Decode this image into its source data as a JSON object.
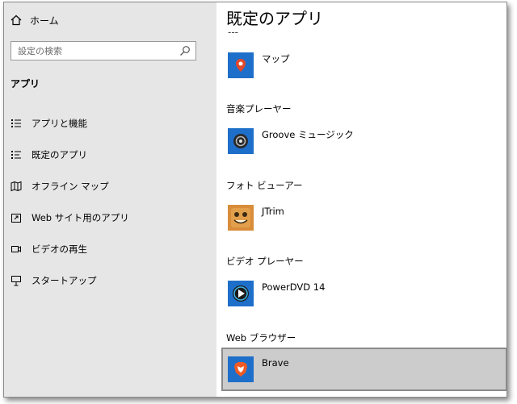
{
  "sidebar": {
    "home_label": "ホーム",
    "search_placeholder": "設定の検索",
    "section_title": "アプリ",
    "items": [
      {
        "label": "アプリと機能",
        "icon": "list-icon"
      },
      {
        "label": "既定のアプリ",
        "icon": "default-apps-icon"
      },
      {
        "label": "オフライン マップ",
        "icon": "map-icon"
      },
      {
        "label": "Web サイト用のアプリ",
        "icon": "external-icon"
      },
      {
        "label": "ビデオの再生",
        "icon": "video-icon"
      },
      {
        "label": "スタートアップ",
        "icon": "startup-icon"
      }
    ]
  },
  "main": {
    "title": "既定のアプリ",
    "groups": [
      {
        "label": "",
        "app": "マップ",
        "icon": "maps-app-icon",
        "tile_color": "#1e6fc9"
      },
      {
        "label": "音楽プレーヤー",
        "app": "Groove ミュージック",
        "icon": "groove-app-icon",
        "tile_color": "#1e6fc9"
      },
      {
        "label": "フォト ビューアー",
        "app": "JTrim",
        "icon": "jtrim-app-icon",
        "tile_color": "#1e6fc9"
      },
      {
        "label": "ビデオ プレーヤー",
        "app": "PowerDVD 14",
        "icon": "powerdvd-app-icon",
        "tile_color": "#1e6fc9"
      },
      {
        "label": "Web ブラウザー",
        "app": "Brave",
        "icon": "brave-app-icon",
        "tile_color": "#1e6fc9"
      }
    ]
  },
  "colors": {
    "sidebar_bg": "#e6e6e6",
    "accent_tile": "#1e6fc9",
    "selected_bg": "#cccccc"
  }
}
